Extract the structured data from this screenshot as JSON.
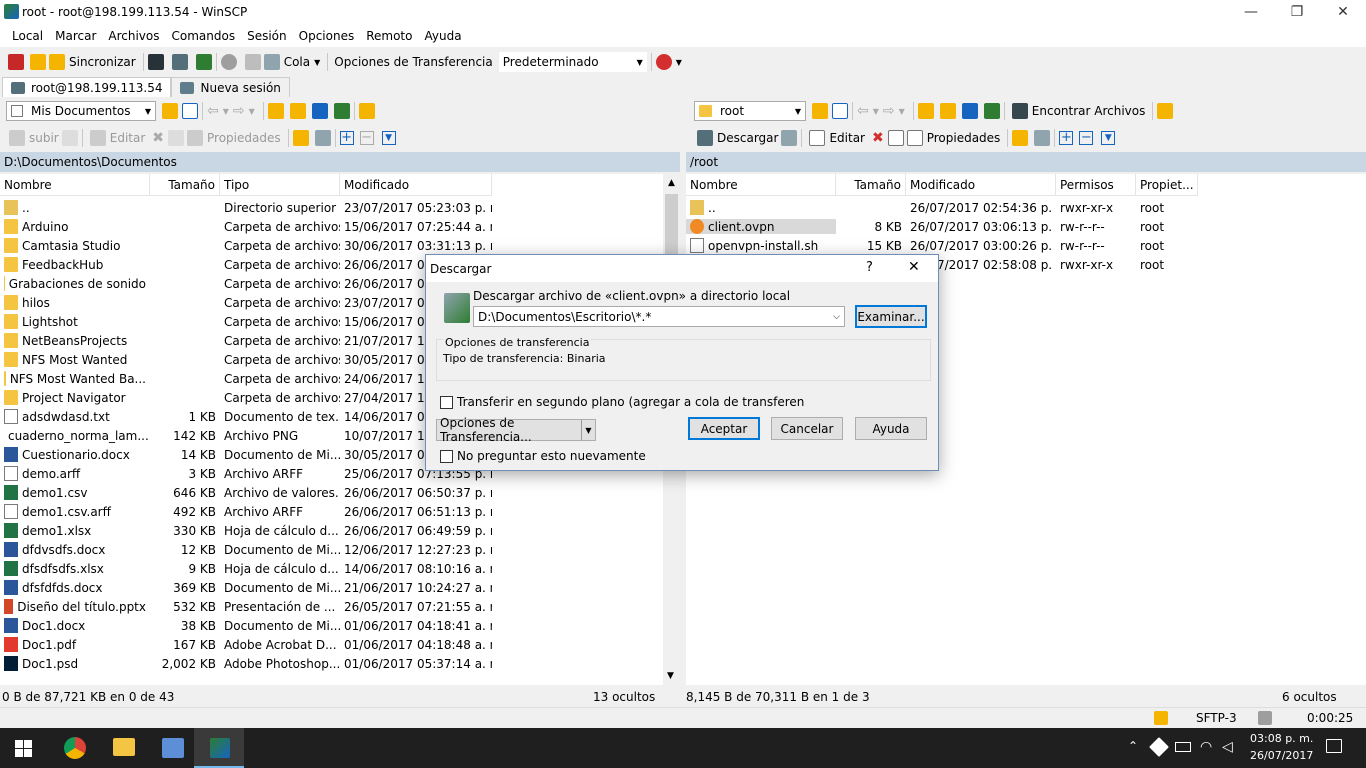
{
  "window": {
    "title": "root - root@198.199.113.54 - WinSCP"
  },
  "menu": [
    "Local",
    "Marcar",
    "Archivos",
    "Comandos",
    "Sesión",
    "Opciones",
    "Remoto",
    "Ayuda"
  ],
  "toolbar": {
    "sync_label": "Sincronizar",
    "queue_label": "Cola",
    "transfer_options_label": "Opciones de Transferencia",
    "transfer_preset": "Predeterminado"
  },
  "tabs": [
    {
      "label": "root@198.199.113.54"
    },
    {
      "label": "Nueva sesión"
    }
  ],
  "local": {
    "location": "Mis Documentos",
    "actions": {
      "upload": "subir",
      "edit": "Editar",
      "properties": "Propiedades"
    },
    "path": "D:\\Documentos\\Documentos",
    "columns": [
      "Nombre",
      "Tamaño",
      "Tipo",
      "Modificado"
    ],
    "files": [
      {
        "icon": "up",
        "name": "..",
        "size": "",
        "type": "Directorio superior",
        "modified": "23/07/2017 05:23:03 p. m."
      },
      {
        "icon": "folder",
        "name": "Arduino",
        "size": "",
        "type": "Carpeta de archivos",
        "modified": "15/06/2017 07:25:44 a. m."
      },
      {
        "icon": "folder",
        "name": "Camtasia Studio",
        "size": "",
        "type": "Carpeta de archivos",
        "modified": "30/06/2017 03:31:13 p. m."
      },
      {
        "icon": "folder",
        "name": "FeedbackHub",
        "size": "",
        "type": "Carpeta de archivos",
        "modified": "26/06/2017 08"
      },
      {
        "icon": "folder",
        "name": "Grabaciones de sonido",
        "size": "",
        "type": "Carpeta de archivos",
        "modified": "26/06/2017 08"
      },
      {
        "icon": "folder",
        "name": "hilos",
        "size": "",
        "type": "Carpeta de archivos",
        "modified": "23/07/2017 05"
      },
      {
        "icon": "folder",
        "name": "Lightshot",
        "size": "",
        "type": "Carpeta de archivos",
        "modified": "15/06/2017 09"
      },
      {
        "icon": "folder",
        "name": "NetBeansProjects",
        "size": "",
        "type": "Carpeta de archivos",
        "modified": "21/07/2017 12"
      },
      {
        "icon": "folder",
        "name": "NFS Most Wanted",
        "size": "",
        "type": "Carpeta de archivos",
        "modified": "30/05/2017 09"
      },
      {
        "icon": "folder",
        "name": "NFS Most Wanted Ba...",
        "size": "",
        "type": "Carpeta de archivos",
        "modified": "24/06/2017 10"
      },
      {
        "icon": "folder",
        "name": "Project Navigator",
        "size": "",
        "type": "Carpeta de archivos",
        "modified": "27/04/2017 12"
      },
      {
        "icon": "doc",
        "name": "adsdwdasd.txt",
        "size": "1 KB",
        "type": "Documento de tex...",
        "modified": "14/06/2017 08"
      },
      {
        "icon": "png",
        "name": "cuaderno_norma_lam...",
        "size": "142 KB",
        "type": "Archivo PNG",
        "modified": "10/07/2017 12"
      },
      {
        "icon": "word",
        "name": "Cuestionario.docx",
        "size": "14 KB",
        "type": "Documento de Mi...",
        "modified": "30/05/2017 08"
      },
      {
        "icon": "doc",
        "name": "demo.arff",
        "size": "3 KB",
        "type": "Archivo ARFF",
        "modified": "25/06/2017 07:13:55 p. m."
      },
      {
        "icon": "excel",
        "name": "demo1.csv",
        "size": "646 KB",
        "type": "Archivo de valores...",
        "modified": "26/06/2017 06:50:37 p. m."
      },
      {
        "icon": "doc",
        "name": "demo1.csv.arff",
        "size": "492 KB",
        "type": "Archivo ARFF",
        "modified": "26/06/2017 06:51:13 p. m."
      },
      {
        "icon": "excel",
        "name": "demo1.xlsx",
        "size": "330 KB",
        "type": "Hoja de cálculo d...",
        "modified": "26/06/2017 06:49:59 p. m."
      },
      {
        "icon": "word",
        "name": "dfdvsdfs.docx",
        "size": "12 KB",
        "type": "Documento de Mi...",
        "modified": "12/06/2017 12:27:23 p. m."
      },
      {
        "icon": "excel",
        "name": "dfsdfsdfs.xlsx",
        "size": "9 KB",
        "type": "Hoja de cálculo d...",
        "modified": "14/06/2017 08:10:16 a. m."
      },
      {
        "icon": "word",
        "name": "dfsfdfds.docx",
        "size": "369 KB",
        "type": "Documento de Mi...",
        "modified": "21/06/2017 10:24:27 a. m."
      },
      {
        "icon": "ppt",
        "name": "Diseño del título.pptx",
        "size": "532 KB",
        "type": "Presentación de ...",
        "modified": "26/05/2017 07:21:55 a. m."
      },
      {
        "icon": "word",
        "name": "Doc1.docx",
        "size": "38 KB",
        "type": "Documento de Mi...",
        "modified": "01/06/2017 04:18:41 a. m."
      },
      {
        "icon": "pdf",
        "name": "Doc1.pdf",
        "size": "167 KB",
        "type": "Adobe Acrobat D...",
        "modified": "01/06/2017 04:18:48 a. m."
      },
      {
        "icon": "psd",
        "name": "Doc1.psd",
        "size": "2,002 KB",
        "type": "Adobe Photoshop...",
        "modified": "01/06/2017 05:37:14 a. m."
      }
    ],
    "status_left": "0 B de 87,721 KB en 0 de 43",
    "status_right": "13 ocultos"
  },
  "remote": {
    "location": "root",
    "find_label": "Encontrar Archivos",
    "actions": {
      "download": "Descargar",
      "edit": "Editar",
      "properties": "Propiedades"
    },
    "path": "/root",
    "columns": [
      "Nombre",
      "Tamaño",
      "Modificado",
      "Permisos",
      "Propiet..."
    ],
    "files": [
      {
        "icon": "up",
        "name": "..",
        "size": "",
        "modified": "26/07/2017 02:54:36 p. m.",
        "perms": "rwxr-xr-x",
        "owner": "root"
      },
      {
        "icon": "ovpn",
        "name": "client.ovpn",
        "size": "8 KB",
        "modified": "26/07/2017 03:06:13 p. m.",
        "perms": "rw-r--r--",
        "owner": "root"
      },
      {
        "icon": "doc",
        "name": "openvpn-install.sh",
        "size": "15 KB",
        "modified": "26/07/2017 03:00:26 p. m.",
        "perms": "rw-r--r--",
        "owner": "root"
      },
      {
        "icon": "",
        "name": "",
        "size": "",
        "modified": "26/07/2017 02:58:08 p. m.",
        "perms": "rwxr-xr-x",
        "owner": "root"
      }
    ],
    "status_left": "8,145 B de 70,311 B en 1 de 3",
    "status_right": "6 ocultos"
  },
  "bottom": {
    "protocol": "SFTP-3",
    "timer": "0:00:25"
  },
  "dialog": {
    "title": "Descargar",
    "help_glyph": "?",
    "close_glyph": "✕",
    "prompt": "Descargar archivo de «client.ovpn» a directorio local",
    "target": "D:\\Documentos\\Escritorio\\*.*",
    "browse": "Examinar...",
    "group_title": "Opciones de transferencia",
    "group_text": "Tipo de transferencia: Binaria",
    "background_check": "Transferir en segundo plano (agregar a cola de transferen",
    "options_btn": "Opciones de Transferencia...",
    "ok": "Aceptar",
    "cancel": "Cancelar",
    "help": "Ayuda",
    "dont_ask": "No preguntar esto nuevamente"
  },
  "taskbar": {
    "time": "03:08 p. m.",
    "date": "26/07/2017"
  }
}
